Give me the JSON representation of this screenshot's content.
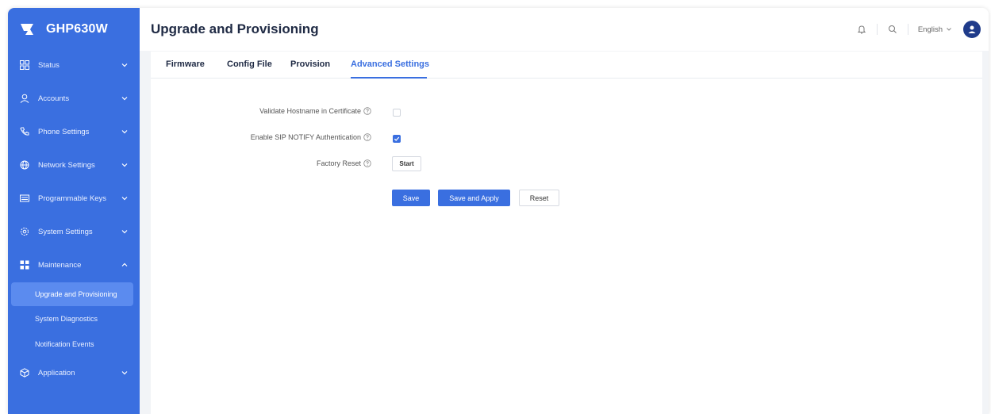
{
  "brand": {
    "name": "GHP630W"
  },
  "sidebar": {
    "items": [
      {
        "label": "Status",
        "icon": "status-icon",
        "expanded": false
      },
      {
        "label": "Accounts",
        "icon": "user-icon",
        "expanded": false
      },
      {
        "label": "Phone Settings",
        "icon": "phone-icon",
        "expanded": false
      },
      {
        "label": "Network Settings",
        "icon": "globe-icon",
        "expanded": false
      },
      {
        "label": "Programmable Keys",
        "icon": "keyboard-icon",
        "expanded": false
      },
      {
        "label": "System Settings",
        "icon": "gear-icon",
        "expanded": false
      },
      {
        "label": "Maintenance",
        "icon": "grid-icon",
        "expanded": true
      },
      {
        "label": "Application",
        "icon": "cube-icon",
        "expanded": false
      }
    ],
    "maintenance_sub": [
      {
        "label": "Upgrade and Provisioning",
        "active": true
      },
      {
        "label": "System Diagnostics",
        "active": false
      },
      {
        "label": "Notification Events",
        "active": false
      }
    ]
  },
  "header": {
    "title": "Upgrade and Provisioning",
    "language": "English"
  },
  "tabs": [
    {
      "label": "Firmware",
      "active": false
    },
    {
      "label": "Config File",
      "active": false
    },
    {
      "label": "Provision",
      "active": false
    },
    {
      "label": "Advanced Settings",
      "active": true
    }
  ],
  "form": {
    "validate_hostname": {
      "label": "Validate Hostname in Certificate",
      "checked": false
    },
    "enable_sip_notify": {
      "label": "Enable SIP NOTIFY Authentication",
      "checked": true
    },
    "factory_reset": {
      "label": "Factory Reset",
      "button": "Start"
    }
  },
  "actions": {
    "save": "Save",
    "save_apply": "Save and Apply",
    "reset": "Reset"
  },
  "colors": {
    "accent": "#3a6fe0",
    "sidebar_bg": "#3a6fe0",
    "title": "#1f2a44"
  }
}
